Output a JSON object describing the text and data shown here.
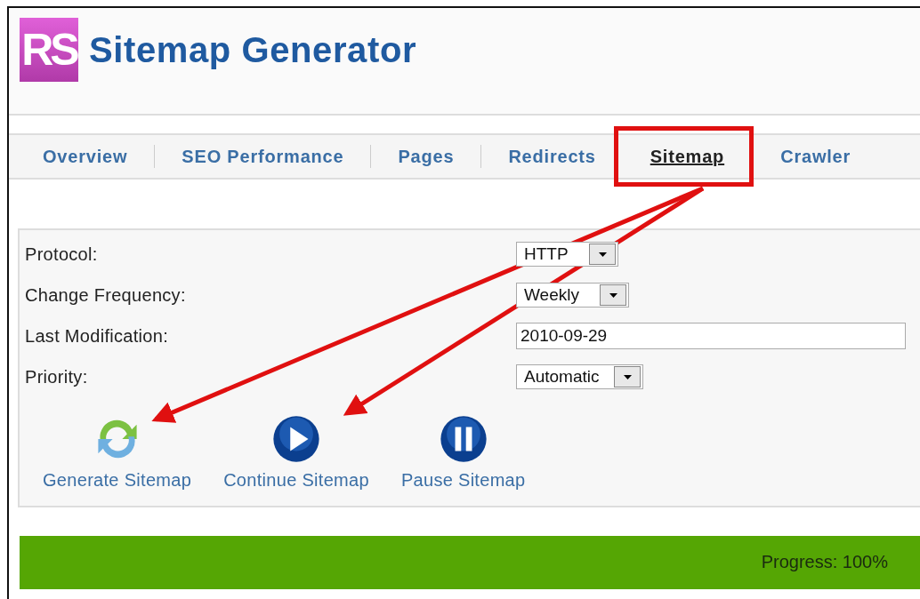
{
  "header": {
    "logo": "RS",
    "title": "Sitemap Generator"
  },
  "tabs": [
    {
      "label": "Overview",
      "selected": false,
      "annotated": false
    },
    {
      "label": "SEO Performance",
      "selected": false,
      "annotated": false
    },
    {
      "label": "Pages",
      "selected": false,
      "annotated": false
    },
    {
      "label": "Redirects",
      "selected": false,
      "annotated": false
    },
    {
      "label": "Sitemap",
      "selected": true,
      "annotated": true
    },
    {
      "label": "Crawler",
      "selected": false,
      "annotated": false
    }
  ],
  "form": {
    "fields": [
      {
        "label": "Protocol:",
        "kind": "select",
        "value": "HTTP"
      },
      {
        "label": "Change Frequency:",
        "kind": "select",
        "value": "Weekly"
      },
      {
        "label": "Last Modification:",
        "kind": "text",
        "value": "2010-09-29"
      },
      {
        "label": "Priority:",
        "kind": "select",
        "value": "Automatic"
      }
    ],
    "actions": [
      {
        "label": "Generate Sitemap",
        "kind": "refresh"
      },
      {
        "label": "Continue Sitemap",
        "kind": "play"
      },
      {
        "label": "Pause Sitemap",
        "kind": "pause"
      }
    ]
  },
  "progress": {
    "level": 1,
    "text": "Progress: 100%"
  }
}
